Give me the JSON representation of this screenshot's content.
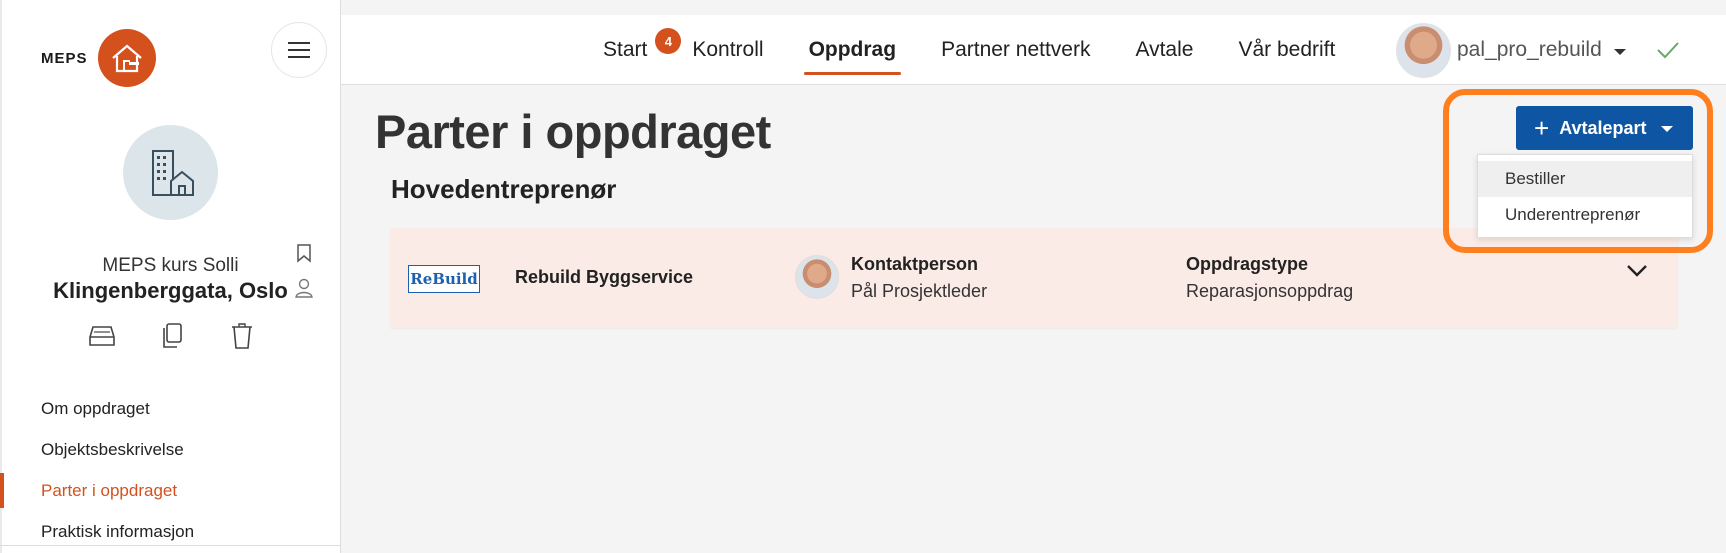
{
  "sidebar": {
    "logo_text": "MEPS",
    "project_name": "MEPS kurs Solli",
    "project_address": "Klingenberggata, Oslo",
    "nav": [
      {
        "label": "Om oppdraget",
        "active": false
      },
      {
        "label": "Objektsbeskrivelse",
        "active": false
      },
      {
        "label": "Parter i oppdraget",
        "active": true
      },
      {
        "label": "Praktisk informasjon",
        "active": false
      }
    ]
  },
  "topnav": {
    "items": [
      {
        "label": "Start",
        "badge": "4"
      },
      {
        "label": "Kontroll"
      },
      {
        "label": "Oppdrag",
        "active": true
      },
      {
        "label": "Partner nettverk"
      },
      {
        "label": "Avtale"
      },
      {
        "label": "Vår bedrift"
      }
    ],
    "username": "pal_pro_rebuild"
  },
  "main": {
    "title": "Parter i oppdraget",
    "section": "Hovedentreprenør",
    "card": {
      "logo_text": "ReBuild",
      "company": "Rebuild Byggservice",
      "contact_label": "Kontaktperson",
      "contact_value": "Pål Prosjektleder",
      "type_label": "Oppdragstype",
      "type_value": "Reparasjonsoppdrag"
    },
    "add_button": "Avtalepart",
    "dropdown": [
      "Bestiller",
      "Underentreprenør"
    ]
  },
  "colors": {
    "accent": "#d4511e",
    "primary": "#0e56a4",
    "highlight": "#ff7f1f",
    "card_bg": "#fbebe6"
  }
}
